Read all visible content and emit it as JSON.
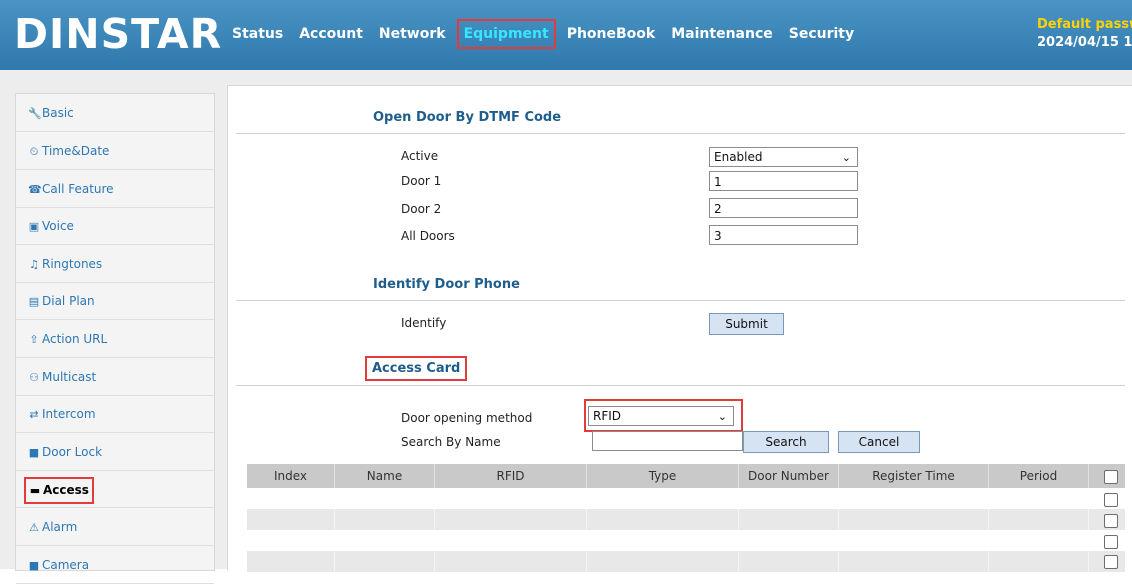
{
  "header": {
    "logo": "DINSTAR",
    "nav": [
      "Status",
      "Account",
      "Network",
      "Equipment",
      "PhoneBook",
      "Maintenance",
      "Security"
    ],
    "active_nav": "Equipment",
    "warning": "Default password",
    "datetime": "2024/04/15 1"
  },
  "sidebar": {
    "items": [
      {
        "label": "Basic",
        "icon": "wrench-icon",
        "glyph": "🔧"
      },
      {
        "label": "Time&Date",
        "icon": "clock-icon",
        "glyph": "⏲"
      },
      {
        "label": "Call Feature",
        "icon": "phone-icon",
        "glyph": "☎"
      },
      {
        "label": "Voice",
        "icon": "voice-icon",
        "glyph": "▣"
      },
      {
        "label": "Ringtones",
        "icon": "bell-icon",
        "glyph": "♫"
      },
      {
        "label": "Dial Plan",
        "icon": "list-icon",
        "glyph": "▤"
      },
      {
        "label": "Action URL",
        "icon": "upload-icon",
        "glyph": "⇧"
      },
      {
        "label": "Multicast",
        "icon": "group-icon",
        "glyph": "⚇"
      },
      {
        "label": "Intercom",
        "icon": "swap-icon",
        "glyph": "⇄"
      },
      {
        "label": "Door Lock",
        "icon": "lock-icon",
        "glyph": "■"
      },
      {
        "label": "Access",
        "icon": "card-icon",
        "glyph": "▬"
      },
      {
        "label": "Alarm",
        "icon": "warning-icon",
        "glyph": "⚠"
      },
      {
        "label": "Camera",
        "icon": "camera-icon",
        "glyph": "■"
      }
    ],
    "active": "Access"
  },
  "dtmf": {
    "title": "Open Door By DTMF Code",
    "active_label": "Active",
    "active_value": "Enabled",
    "door1_label": "Door 1",
    "door1_value": "1",
    "door2_label": "Door 2",
    "door2_value": "2",
    "all_label": "All Doors",
    "all_value": "3"
  },
  "identify": {
    "title": "Identify Door Phone",
    "label": "Identify",
    "submit": "Submit"
  },
  "access": {
    "title": "Access Card",
    "method_label": "Door opening method",
    "method_value": "RFID",
    "search_label": "Search By Name",
    "search_value": "",
    "search_button": "Search",
    "cancel_button": "Cancel"
  },
  "table": {
    "headers": [
      "Index",
      "Name",
      "RFID",
      "Type",
      "Door Number",
      "Register Time",
      "Period"
    ],
    "rows": 4
  }
}
